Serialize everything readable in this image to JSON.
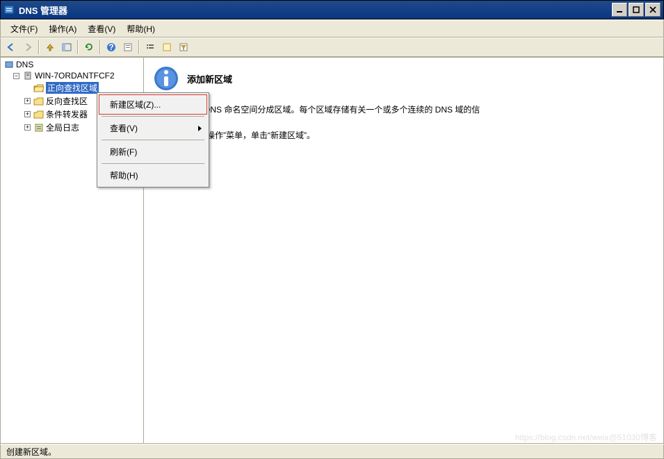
{
  "window": {
    "title": "DNS 管理器"
  },
  "menus": {
    "file": "文件(F)",
    "action": "操作(A)",
    "view": "查看(V)",
    "help": "帮助(H)"
  },
  "tree": {
    "root": "DNS",
    "server": "WIN-7ORDANTFCF2",
    "fwd": "正向查找区域",
    "rev": "反向查找区",
    "cond": "条件转发器",
    "global": "全局日志"
  },
  "content": {
    "heading": "添加新区域",
    "p1": "(DNS)允许将 DNS 命名空间分成区域。每个区域存储有关一个或多个连续的 DNS 域的信",
    "p2": "新区域，请在“操作”菜单，单击“新建区域”。"
  },
  "context_menu": {
    "newzone": "新建区域(Z)...",
    "view": "查看(V)",
    "refresh": "刷新(F)",
    "help": "帮助(H)"
  },
  "statusbar": {
    "text": "创建新区域。"
  },
  "watermark": "https://blog.csdn.net/weix@51030博客"
}
